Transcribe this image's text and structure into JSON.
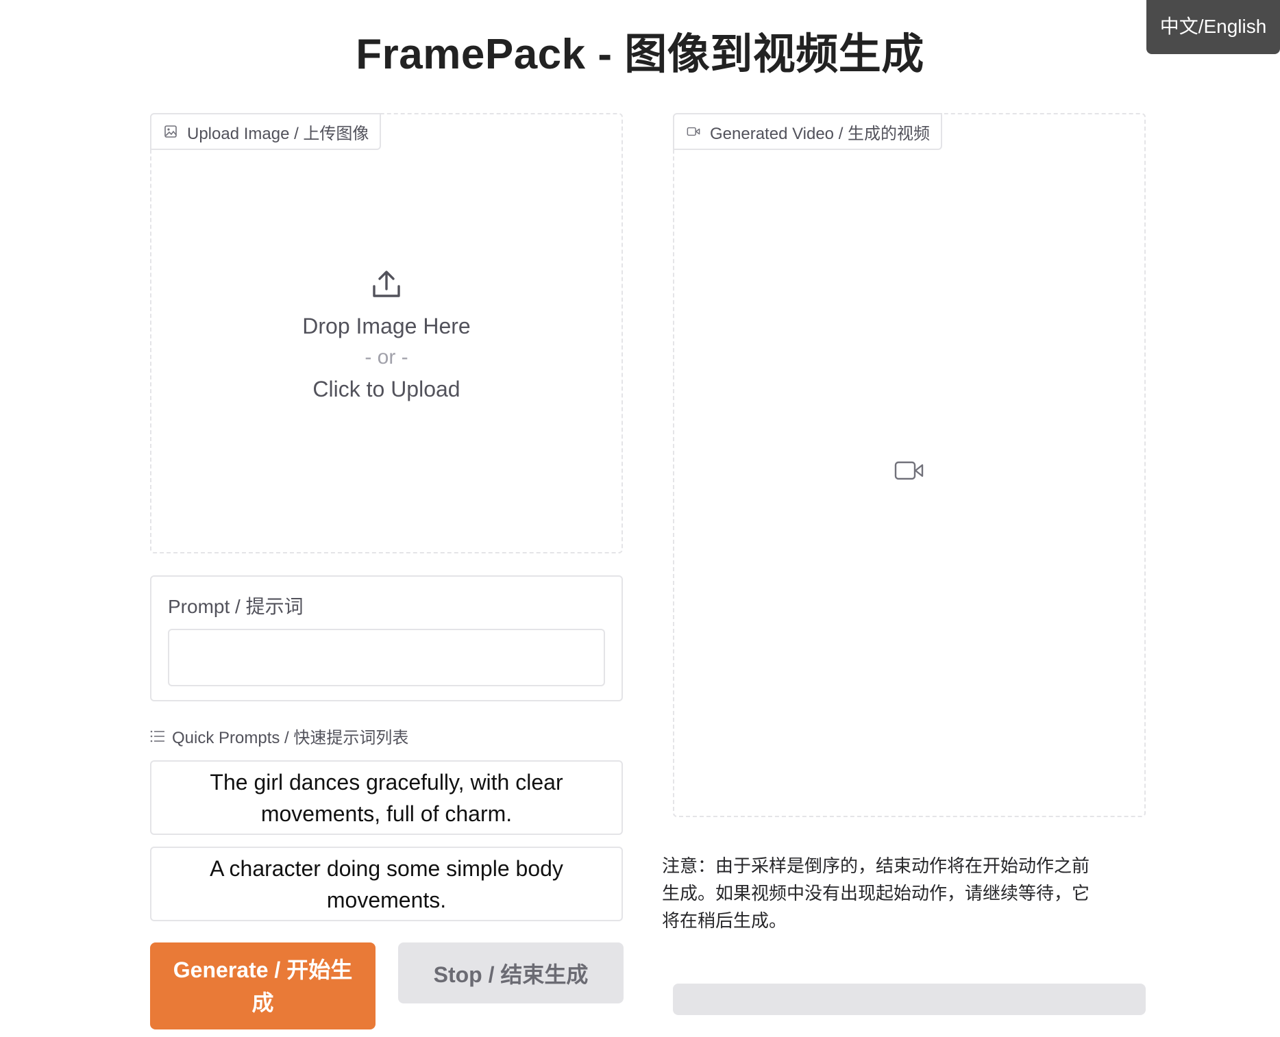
{
  "lang_toggle": "中文/English",
  "title": "FramePack - 图像到视频生成",
  "upload": {
    "tab_label": "Upload Image / 上传图像",
    "tab_icon": "image-icon",
    "drop_text": "Drop Image Here",
    "or_text": "- or -",
    "click_text": "Click to Upload",
    "icon": "upload-icon"
  },
  "video": {
    "tab_label": "Generated Video / 生成的视频",
    "tab_icon": "video-icon",
    "placeholder_icon": "video-camera-icon"
  },
  "prompt": {
    "label": "Prompt / 提示词",
    "value": "",
    "placeholder": ""
  },
  "quick_prompts": {
    "label": "Quick Prompts / 快速提示词列表",
    "icon": "list-icon",
    "items": [
      "The girl dances gracefully, with clear movements, full of charm.",
      "A character doing some simple body movements."
    ]
  },
  "buttons": {
    "generate": "Generate / 开始生成",
    "stop": "Stop / 结束生成"
  },
  "note": "注意：由于采样是倒序的，结束动作将在开始动作之前生成。如果视频中没有出现起始动作，请继续等待，它将在稍后生成。",
  "progress": {
    "value": 0
  },
  "colors": {
    "accent": "#e97a37",
    "border": "#e4e4e7",
    "lang_toggle_bg": "#4b4b4b"
  }
}
